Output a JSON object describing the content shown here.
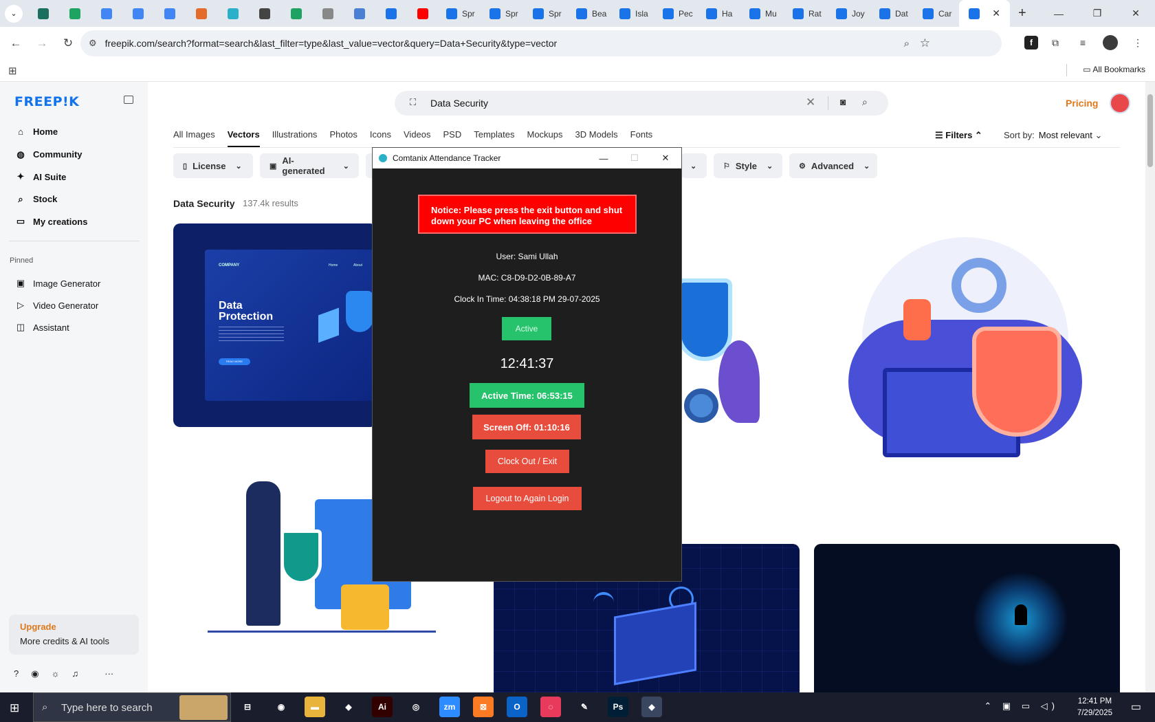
{
  "browser": {
    "tabs": [
      {
        "label": "",
        "color": "#1b6f5f"
      },
      {
        "label": "",
        "color": "#1ea362"
      },
      {
        "label": "",
        "color": "#4285f4"
      },
      {
        "label": "",
        "color": "#4285f4"
      },
      {
        "label": "",
        "color": "#4285f4"
      },
      {
        "label": "",
        "color": "#e36c2a"
      },
      {
        "label": "",
        "color": "#2bb0c9"
      },
      {
        "label": "",
        "color": "#444444"
      },
      {
        "label": "",
        "color": "#1ea362"
      },
      {
        "label": "",
        "color": "#888888"
      },
      {
        "label": "",
        "color": "#4a7fd4"
      },
      {
        "label": "",
        "color": "#1a73e8"
      },
      {
        "label": "",
        "color": "#ff0000"
      },
      {
        "label": "Spr",
        "color": "#1a73e8"
      },
      {
        "label": "Spr",
        "color": "#1a73e8"
      },
      {
        "label": "Spr",
        "color": "#1a73e8"
      },
      {
        "label": "Bea",
        "color": "#1a73e8"
      },
      {
        "label": "Isla",
        "color": "#1a73e8"
      },
      {
        "label": "Pec",
        "color": "#1a73e8"
      },
      {
        "label": "Ha",
        "color": "#1a73e8"
      },
      {
        "label": "Mu",
        "color": "#1a73e8"
      },
      {
        "label": "Rat",
        "color": "#1a73e8"
      },
      {
        "label": "Joy",
        "color": "#1a73e8"
      },
      {
        "label": "Dat",
        "color": "#1a73e8"
      },
      {
        "label": "Car",
        "color": "#1a73e8"
      }
    ],
    "active_tab_color": "#1a73e8",
    "url": "freepik.com/search?format=search&last_filter=type&last_value=vector&query=Data+Security&type=vector",
    "bookmarks_label": "All Bookmarks"
  },
  "sidebar": {
    "logo": "FREEP!K",
    "items": [
      {
        "label": "Home",
        "icon": "home-icon",
        "glyph": "⌂"
      },
      {
        "label": "Community",
        "icon": "globe-icon",
        "glyph": "◍"
      },
      {
        "label": "AI Suite",
        "icon": "sparkle-icon",
        "glyph": "✦"
      },
      {
        "label": "Stock",
        "icon": "search-icon",
        "glyph": "⌕"
      },
      {
        "label": "My creations",
        "icon": "folder-icon",
        "glyph": "▭"
      }
    ],
    "pinned_label": "Pinned",
    "pinned": [
      {
        "label": "Image Generator",
        "icon": "image-icon",
        "glyph": "▣"
      },
      {
        "label": "Video Generator",
        "icon": "video-icon",
        "glyph": "▷"
      },
      {
        "label": "Assistant",
        "icon": "assistant-icon",
        "glyph": "◫"
      }
    ],
    "upgrade_title": "Upgrade",
    "upgrade_sub": "More credits & AI tools"
  },
  "main": {
    "search_query": "Data Security",
    "pricing": "Pricing",
    "categories": [
      "All Images",
      "Vectors",
      "Illustrations",
      "Photos",
      "Icons",
      "Videos",
      "PSD",
      "Templates",
      "Mockups",
      "3D Models",
      "Fonts"
    ],
    "active_category": "Vectors",
    "filters_label": "Filters",
    "sort_label": "Sort by:",
    "sort_value": "Most relevant",
    "chips": [
      "License",
      "AI-generated",
      "Style",
      "Advanced"
    ],
    "result_title": "Data Security",
    "result_count": "137.4k results",
    "card1": {
      "brand": "COMPANY",
      "nav1": "Home",
      "nav2": "About",
      "heading1": "Data",
      "heading2": "Protection",
      "cta": "READ MORE"
    }
  },
  "dialog": {
    "title": "Comtanix Attendance Tracker",
    "notice": "Notice: Please press the exit button and shut down your PC when leaving the office",
    "user": "User: Sami Ullah",
    "mac": "MAC: C8-D9-D2-0B-89-A7",
    "clock_in": "Clock In Time: 04:38:18 PM 29-07-2025",
    "status": "Active",
    "time": "12:41:37",
    "active_time": "Active Time: 06:53:15",
    "screen_off": "Screen Off: 01:10:16",
    "clock_out": "Clock Out / Exit",
    "logout": "Logout to Again Login",
    "colors": {
      "green": "#27c26c",
      "red": "#e84c3d",
      "notice": "#ff0000"
    }
  },
  "taskbar": {
    "search_placeholder": "Type here to search",
    "time": "12:41 PM",
    "date": "7/29/2025",
    "apps": [
      {
        "icon": "task-view-icon",
        "glyph": "⊟",
        "bg": "transparent"
      },
      {
        "icon": "firefox-icon",
        "glyph": "◉",
        "bg": "transparent"
      },
      {
        "icon": "file-explorer-icon",
        "glyph": "▬",
        "bg": "#e8b43c"
      },
      {
        "icon": "vscode-icon",
        "glyph": "◆",
        "bg": "transparent"
      },
      {
        "icon": "illustrator-icon",
        "glyph": "Ai",
        "bg": "#330000"
      },
      {
        "icon": "chrome-icon",
        "glyph": "◎",
        "bg": "transparent"
      },
      {
        "icon": "zoom-icon",
        "glyph": "zm",
        "bg": "#2d8cff"
      },
      {
        "icon": "xampp-icon",
        "glyph": "⊠",
        "bg": "#fb7a24"
      },
      {
        "icon": "outlook-icon",
        "glyph": "O",
        "bg": "#0a64c8"
      },
      {
        "icon": "creative-cloud-icon",
        "glyph": "◌",
        "bg": "#e83a5a"
      },
      {
        "icon": "pen-icon",
        "glyph": "✎",
        "bg": "transparent"
      },
      {
        "icon": "photoshop-icon",
        "glyph": "Ps",
        "bg": "#001e36"
      },
      {
        "icon": "tracker-icon",
        "glyph": "◆",
        "bg": "#3a4560"
      }
    ]
  }
}
